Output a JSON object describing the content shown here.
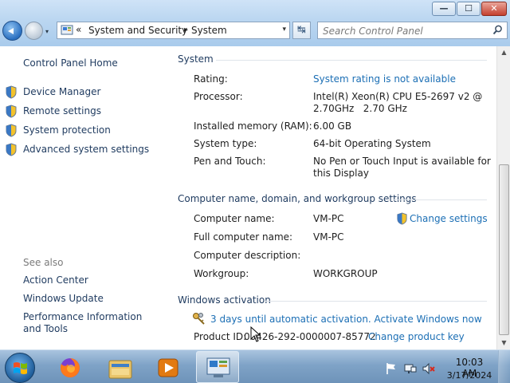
{
  "window": {
    "minimize_glyph": "—",
    "maximize_glyph": "☐",
    "close_glyph": "✕"
  },
  "nav": {
    "dropdown_glyph": "▾",
    "refresh_glyph": "↹"
  },
  "address": {
    "chevron": "«",
    "crumbs": [
      "System and Security",
      "System"
    ],
    "separator": "▸",
    "dropdown_glyph": "▾"
  },
  "search": {
    "placeholder": "Search Control Panel"
  },
  "sidebar": {
    "home": "Control Panel Home",
    "tasks": [
      {
        "label": "Device Manager"
      },
      {
        "label": "Remote settings"
      },
      {
        "label": "System protection"
      },
      {
        "label": "Advanced system settings"
      }
    ],
    "see_also_title": "See also",
    "see_also": [
      {
        "label": "Action Center"
      },
      {
        "label": "Windows Update"
      },
      {
        "label": "Performance Information and Tools"
      }
    ]
  },
  "system": {
    "header": "System",
    "rating_label": "Rating:",
    "rating_value": "System rating is not available",
    "processor_label": "Processor:",
    "processor_value_1": "Intel(R) Xeon(R) CPU E5-2697 v2 @",
    "processor_value_2": "2.70GHz   2.70 GHz",
    "memory_label": "Installed memory (RAM):",
    "memory_value": "6.00 GB",
    "type_label": "System type:",
    "type_value": "64-bit Operating System",
    "pen_label": "Pen and Touch:",
    "pen_value_1": "No Pen or Touch Input is available for",
    "pen_value_2": "this Display"
  },
  "computer": {
    "header": "Computer name, domain, and workgroup settings",
    "name_label": "Computer name:",
    "name_value": "VM-PC",
    "change_settings": "Change settings",
    "fullname_label": "Full computer name:",
    "fullname_value": "VM-PC",
    "desc_label": "Computer description:",
    "desc_value": "",
    "workgroup_label": "Workgroup:",
    "workgroup_value": "WORKGROUP"
  },
  "activation": {
    "header": "Windows activation",
    "message": "3 days until automatic activation. Activate Windows now",
    "product_id_label": "Product ID:",
    "product_id_value": "00426-292-0000007-85772",
    "change_key": "Change product key"
  },
  "taskbar": {
    "apps": [
      "start-orb",
      "firefox-icon",
      "explorer-icon",
      "media-player-icon",
      "control-panel-icon"
    ],
    "clock_time": "10:03 AM",
    "clock_date": "3/17/2024"
  },
  "colors": {
    "link": "#1c6fb5",
    "nav_text": "#1e3a5f",
    "taskbar": "#7fa3c7"
  }
}
